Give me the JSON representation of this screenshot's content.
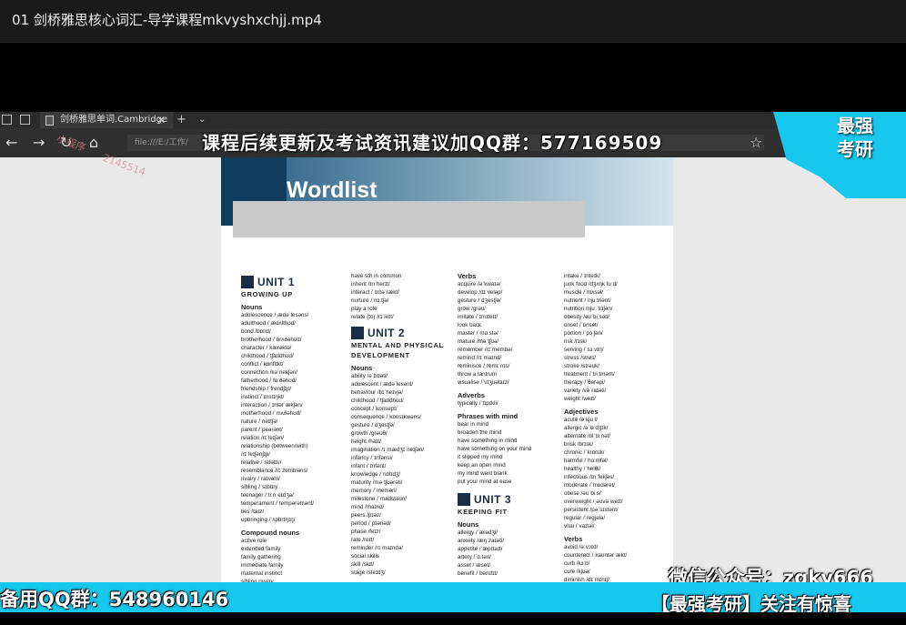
{
  "player": {
    "title": "01 剑桥雅思核心词汇-导学课程mkvyshxchjj.mp4"
  },
  "browser": {
    "tab_title": "剑桥雅思单词.Cambridge",
    "tab_close": "✕",
    "new_tab": "+",
    "tab_menu": "⌄",
    "address": "file:///E:/工作/",
    "watermark_a": "小程序",
    "watermark_b": "2145514"
  },
  "overlays": {
    "top_banner": "课程后续更新及考试资讯建议加QQ群：577169509",
    "corner_line1": "最强",
    "corner_line2": "考研",
    "wechat": "微信公众号：zqky666",
    "bottom_qq": "备用QQ群：548960146",
    "bottom_slogan": "【最强考研】关注有惊喜"
  },
  "doc": {
    "title": "Wordlist",
    "col1": {
      "unit": "UNIT 1",
      "subtitle": "GROWING UP",
      "nouns_head": "Nouns",
      "nouns": [
        "adolescence /ˌædəˈlesəns/",
        "adulthood /ˈædʌlthʊd/",
        "bond /bɒnd/",
        "brotherhood /ˈbrʌðəhʊd/",
        "character /ˈkærəktə/",
        "childhood /ˈtʃaɪldhʊd/",
        "conflict /ˈkɒnflɪkt/",
        "connection /kəˈnekʃən/",
        "fatherhood /ˈfɑːðəhʊd/",
        "friendship /ˈfrendʃɪp/",
        "instinct /ˈɪnstɪŋkt/",
        "interaction /ˌɪntərˈækʃən/",
        "motherhood /ˈmʌðəhʊd/",
        "nature /ˈneɪtʃə/",
        "parent /ˈpeərənt/",
        "relation /rɪˈleɪʃən/",
        "relationship (between/with)",
        "  /rɪˈleɪʃənʃɪp/",
        "relative /ˈrelətɪv/",
        "resemblance /rɪˈzembləns/",
        "rivalry /ˈraɪvəlri/",
        "sibling /ˈsɪblɪŋ/",
        "teenager /ˈtiːnˌeɪdʒə/",
        "temperament /ˈtempərəmənt/",
        "ties /taɪz/",
        "upbringing /ˈʌpbrɪŋɪŋ/"
      ],
      "compound_head": "Compound nouns",
      "compound": [
        "active role",
        "extended family",
        "family gathering",
        "immediate family",
        "maternal instinct",
        "sibling rivalry"
      ]
    },
    "col2": {
      "top": [
        "have sth in common",
        "inherit /ɪnˈherɪt/",
        "interact /ˌɪntəˈrækt/",
        "nurture /ˈnɜːtʃə/",
        "play a role",
        "relate (to) /rɪˈleɪt/"
      ],
      "unit": "UNIT 2",
      "subtitle1": "MENTAL AND PHYSICAL",
      "subtitle2": "DEVELOPMENT",
      "nouns_head": "Nouns",
      "nouns": [
        "ability /əˈbɪləti/",
        "adolescent /ˌædəˈlesənt/",
        "behaviour /bɪˈheɪvjə/",
        "childhood /ˈtʃaɪldhʊd/",
        "concept /ˈkɒnsept/",
        "consequence /ˈkɒnsɪkwəns/",
        "gesture /ˈdʒestʃə/",
        "growth /grəʊθ/",
        "height /haɪt/",
        "imagination /ɪˌmædʒɪˈneɪʃən/",
        "infancy /ˈɪnfənsi/",
        "infant /ˈɪnfənt/",
        "knowledge /ˈnɒlɪdʒ/",
        "maturity /məˈtʃʊərəti/",
        "memory /ˈmeməri/",
        "milestone /ˈmaɪlstəʊn/",
        "mind /maɪnd/",
        "peers /pɪəz/",
        "period /ˈpɪəriəd/",
        "phase /feɪz/",
        "rate /reɪt/",
        "reminder /rɪˈmaɪndə/",
        "social skills",
        "skill /skɪl/",
        "stage /steɪdʒ/"
      ]
    },
    "col3": {
      "verbs_head": "Verbs",
      "verbs": [
        "acquire /əˈkwaɪə/",
        "develop /dɪˈveləp/",
        "gesture /ˈdʒestʃə/",
        "grow /grəʊ/",
        "imitate /ˈɪmɪteɪt/",
        "look back",
        "master /ˈmɑːstə/",
        "mature /məˈtʃʊə/",
        "remember /rɪˈmembə/",
        "remind /rɪˈmaɪnd/",
        "reminisce /ˌremɪˈnɪs/",
        "throw a tantrum",
        "visualise /ˈvɪʒuəlaɪz/"
      ],
      "adverbs_head": "Adverbs",
      "adverbs": [
        "typically /ˈtɪpɪkli/"
      ],
      "phrases_head": "Phrases with mind",
      "phrases": [
        "bear in mind",
        "broaden the mind",
        "have something in mind",
        "have something on your mind",
        "it slipped my mind",
        "keep an open mind",
        "my mind went blank",
        "put your mind at ease"
      ],
      "unit": "UNIT 3",
      "subtitle": "KEEPING FIT",
      "nouns_head": "Nouns",
      "nouns": [
        "allergy /ˈælədʒi/",
        "anxiety /æŋˈzaɪəti/",
        "appetite /ˈæpɪtaɪt/",
        "artery /ˈɑːtəri/",
        "asset /ˈæset/",
        "benefit /ˈbenɪfɪt/"
      ]
    },
    "col4": {
      "top": [
        "intake /ˈɪnteɪk/",
        "junk food /dʒʌŋk fuːd/",
        "muscle /ˈmʌsəl/",
        "nutrient /ˈnjuːtriənt/",
        "nutrition /njuːˈtrɪʃən/",
        "obesity /əʊˈbiːsəti/",
        "onset /ˈɒnset/",
        "portion /ˈpɔːʃən/",
        "risk /rɪsk/",
        "serving /ˈsɜːvɪŋ/",
        "stress /stres/",
        "stroke /strəʊk/",
        "treatment /ˈtriːtmənt/",
        "therapy /ˈθerəpi/",
        "variety /vəˈraɪəti/",
        "weight /weɪt/"
      ],
      "adj_head": "Adjectives",
      "adjectives": [
        "acute /əˈkjuːt/",
        "allergic /əˈlɜːdʒɪk/",
        "alternate /ɒlˈtɜːnət/",
        "brisk /brɪsk/",
        "chronic /ˈkrɒnɪk/",
        "harmful /ˈhɑːmfəl/",
        "healthy /ˈhelθi/",
        "infectious /ɪnˈfekʃəs/",
        "moderate /ˈmɒdərət/",
        "obese /əʊˈbiːs/",
        "overweight /ˌəʊvəˈweɪt/",
        "persistent /pəˈsɪstənt/",
        "regular /ˈregjələ/",
        "vital /ˈvaɪtəl/"
      ],
      "verbs_head": "Verbs",
      "verbs": [
        "avoid /əˈvɔɪd/",
        "counteract /ˌkaʊntərˈækt/",
        "curb /kɜːb/",
        "cure /kjʊə/",
        "diminish /dɪˈmɪnɪʃ/"
      ]
    }
  }
}
